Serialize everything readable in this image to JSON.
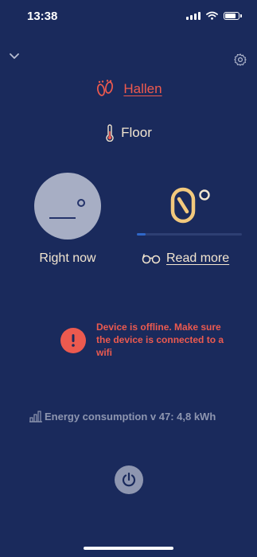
{
  "status_bar": {
    "time": "13:38"
  },
  "header": {
    "collapse_icon": "chevron-down-icon",
    "settings_icon": "gear-icon"
  },
  "room": {
    "name": "Hallen",
    "icon": "footprints-icon",
    "color": "#ef5a4e"
  },
  "mode": {
    "label": "Floor",
    "icon": "thermometer-icon"
  },
  "current": {
    "label": "Right now"
  },
  "target": {
    "progress": 0.08,
    "link_label": "Read more",
    "icon": "glasses-icon"
  },
  "alert": {
    "message": "Device is offline. Make sure the device is connected to a wifi",
    "icon": "exclamation-icon",
    "color": "#ec5a4f"
  },
  "energy": {
    "text": "Energy consumption v 47: 4,8 kWh",
    "icon": "bar-chart-icon"
  },
  "power": {
    "icon": "power-icon"
  },
  "colors": {
    "background": "#1a2a5c",
    "text": "#f3e6d0",
    "muted": "#8e96b0",
    "accent": "#2f67c9"
  }
}
